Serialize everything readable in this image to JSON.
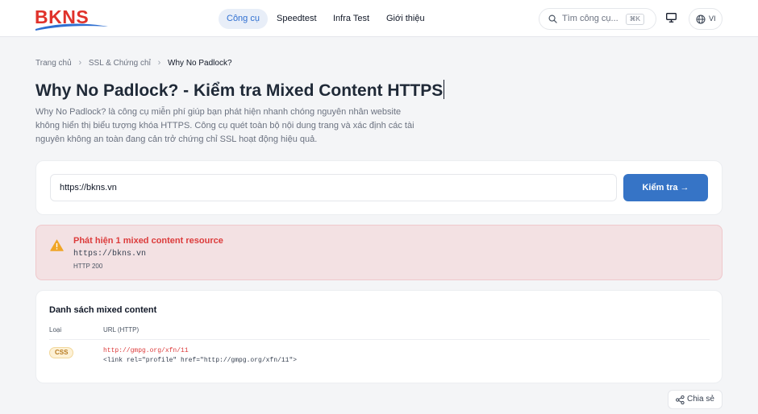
{
  "brand": {
    "logo_text": "BKNS"
  },
  "nav": {
    "items": [
      {
        "label": "Công cụ",
        "active": true
      },
      {
        "label": "Speedtest",
        "active": false
      },
      {
        "label": "Infra Test",
        "active": false
      },
      {
        "label": "Giới thiệu",
        "active": false
      }
    ]
  },
  "search": {
    "placeholder": "Tìm công cụ...",
    "shortcut": "⌘K"
  },
  "language": {
    "code": "VI"
  },
  "breadcrumb": [
    "Trang chủ",
    "SSL & Chứng chỉ",
    "Why No Padlock?"
  ],
  "page": {
    "title": "Why No Padlock? - Kiểm tra Mixed Content HTTPS",
    "description": "Why No Padlock? là công cụ miễn phí giúp bạn phát hiện nhanh chóng nguyên nhân website không hiển thị biểu tượng khóa HTTPS. Công cụ quét toàn bộ nội dung trang và xác định các tài nguyên không an toàn đang cản trở chứng chỉ SSL hoạt động hiệu quả."
  },
  "form": {
    "url_value": "https://bkns.vn",
    "submit_label": "Kiểm tra →"
  },
  "alert": {
    "title": "Phát hiện 1 mixed content resource",
    "url": "https://bkns.vn",
    "status": "HTTP 200"
  },
  "results": {
    "title": "Danh sách mixed content",
    "columns": [
      "Loại",
      "URL (HTTP)"
    ],
    "rows": [
      {
        "type": "CSS",
        "url": "http://gmpg.org/xfn/11",
        "snippet": "<link rel=\"profile\" href=\"http://gmpg.org/xfn/11\">"
      }
    ]
  },
  "share": {
    "label": "Chia sẻ"
  },
  "colors": {
    "accent": "#3674c6",
    "brand_red": "#e0322b",
    "danger": "#dc3b3b",
    "alert_bg": "#f3e1e3"
  }
}
